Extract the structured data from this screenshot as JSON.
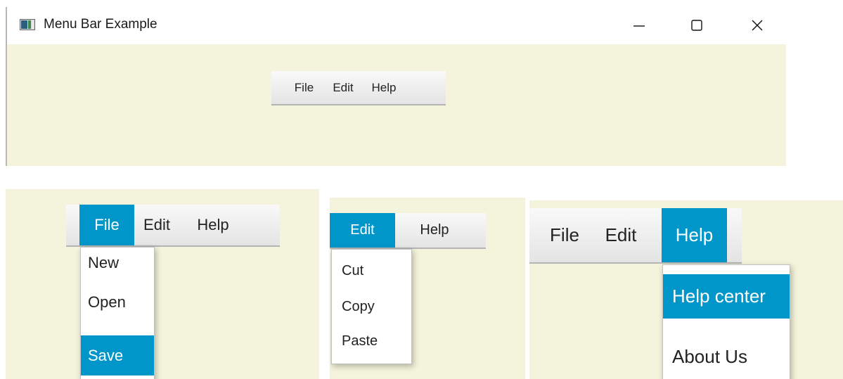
{
  "window": {
    "title": "Menu Bar Example",
    "minimize_glyph": "—",
    "maximize_glyph": "☐",
    "close_glyph": "✕"
  },
  "main_menubar": {
    "items": [
      "File",
      "Edit",
      "Help"
    ]
  },
  "panel_file": {
    "menubar": [
      "File",
      "Edit",
      "Help"
    ],
    "active_menu": "File",
    "dropdown": [
      "New",
      "Open",
      "Save"
    ],
    "highlighted": "Save"
  },
  "panel_edit": {
    "menubar": [
      "Edit",
      "Help"
    ],
    "active_menu": "Edit",
    "dropdown": [
      "Cut",
      "Copy",
      "Paste"
    ]
  },
  "panel_help": {
    "menubar": [
      "File",
      "Edit",
      "Help"
    ],
    "active_menu": "Help",
    "dropdown": [
      "Help center",
      "About Us"
    ],
    "highlighted": "Help center"
  },
  "colors": {
    "content_background": "#f4f4dc",
    "accent": "#0096c9",
    "menubar_top": "#f9f9f9",
    "menubar_bottom": "#e4e4e4"
  },
  "icons": [
    "app-window-icon",
    "minimize-icon",
    "maximize-icon",
    "close-icon"
  ]
}
